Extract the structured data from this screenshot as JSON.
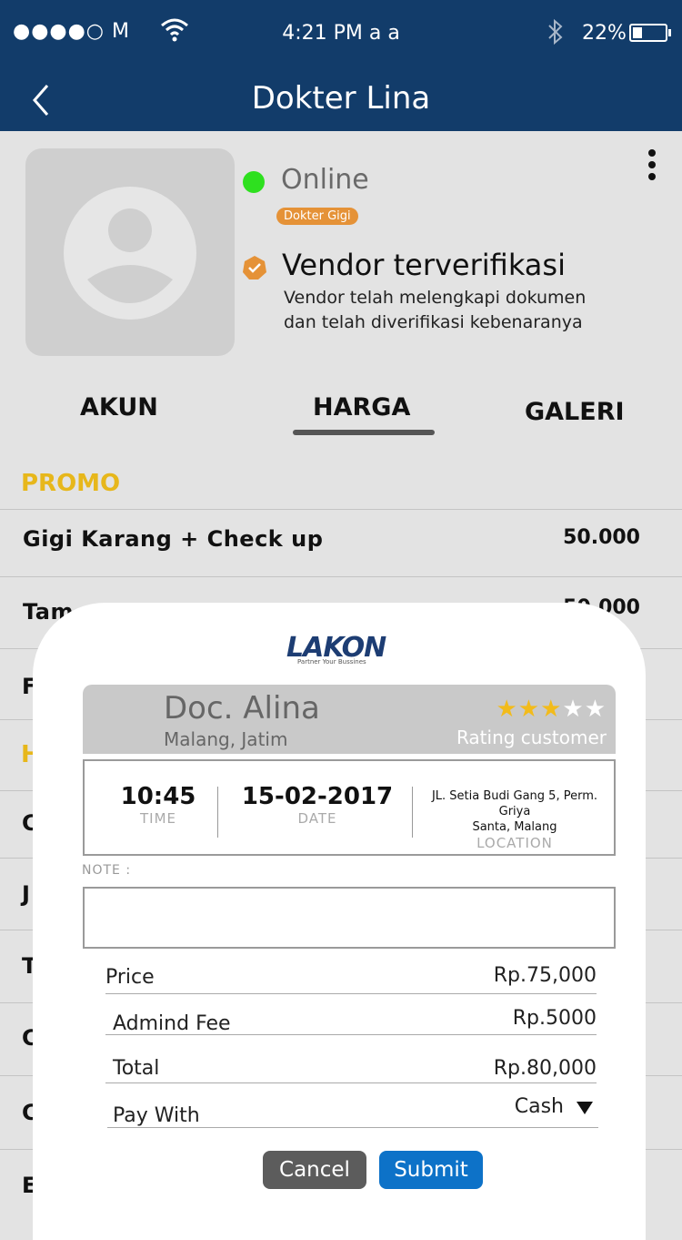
{
  "status_bar": {
    "signal": "●●●●○ M",
    "time": "4:21 PM  a a",
    "battery": "22%"
  },
  "nav": {
    "title": "Dokter Lina"
  },
  "profile": {
    "status": "Online",
    "category_badge": "Dokter Gigi",
    "verified_title": "Vendor terverifikasi",
    "verified_desc_line1": "Vendor telah melengkapi dokumen",
    "verified_desc_line2": "dan telah diverifikasi kebenaranya"
  },
  "tabs": [
    {
      "label": "AKUN"
    },
    {
      "label": "HARGA",
      "active": true
    },
    {
      "label": "GALERI"
    }
  ],
  "price_list": {
    "section_promo": "PROMO",
    "section_other_fragment": "H",
    "rows": [
      {
        "label": "Gigi Karang + Check up",
        "value": "50.000"
      },
      {
        "label_fragment": "Tam",
        "value_fragment": "50.000"
      }
    ],
    "hidden_fragments": [
      "F",
      "C",
      "J",
      "T",
      "C",
      "C",
      "E"
    ]
  },
  "modal": {
    "logo_text": "LAKON",
    "logo_tagline": "Partner Your Bussines",
    "doctor_name": "Doc. Alina",
    "doctor_city": "Malang, Jatim",
    "rating": {
      "value": 3,
      "max": 5,
      "label": "Rating customer"
    },
    "time_value": "10:45",
    "time_label": "TIME",
    "date_value": "15-02-2017",
    "date_label": "DATE",
    "location_line1": "JL. Setia Budi Gang 5, Perm. Griya",
    "location_line2": "Santa, Malang",
    "location_label": "LOCATION",
    "note_label": "NOTE :",
    "note_value": "",
    "price_label": "Price",
    "price_value": "Rp.75,000",
    "fee_label": "Admind Fee",
    "fee_value": "Rp.5000",
    "total_label": "Total",
    "total_value": "Rp.80,000",
    "pay_label": "Pay With",
    "pay_value": "Cash",
    "cancel_label": "Cancel",
    "submit_label": "Submit"
  },
  "colors": {
    "header": "#123c6a",
    "accent_yellow": "#e7b71b",
    "online": "#2ee01f",
    "badge": "#e59237",
    "submit": "#0d72c8",
    "cancel": "#5c5c5c"
  }
}
